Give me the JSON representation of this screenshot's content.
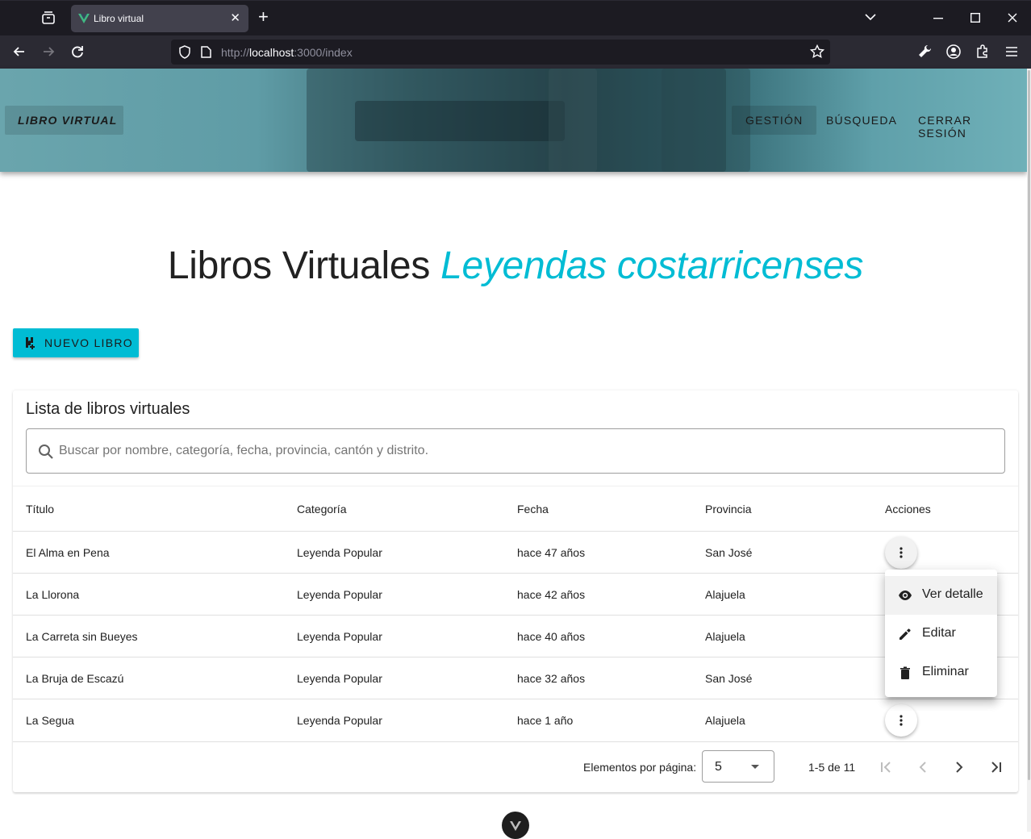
{
  "browser": {
    "tab_title": "Libro virtual",
    "url_prefix": "http://",
    "url_host": "localhost",
    "url_rest": ":3000/index"
  },
  "navbar": {
    "brand": "LIBRO VIRTUAL",
    "items": [
      {
        "label": "GESTIÓN",
        "active": true
      },
      {
        "label": "BÚSQUEDA",
        "active": false
      },
      {
        "label": "CERRAR SESIÓN",
        "active": false
      }
    ]
  },
  "heading": {
    "main": "Libros Virtuales",
    "accent": "Leyendas costarricenses"
  },
  "new_book_button": "NUEVO LIBRO",
  "card": {
    "title": "Lista de libros virtuales",
    "search_placeholder": "Buscar por nombre, categoría, fecha, provincia, cantón y distrito."
  },
  "table": {
    "headers": [
      "Título",
      "Categoría",
      "Fecha",
      "Provincia",
      "Acciones"
    ],
    "rows": [
      [
        "El Alma en Pena",
        "Leyenda Popular",
        "hace 47 años",
        "San José"
      ],
      [
        "La Llorona",
        "Leyenda Popular",
        "hace 42 años",
        "Alajuela"
      ],
      [
        "La Carreta sin Bueyes",
        "Leyenda Popular",
        "hace 40 años",
        "Alajuela"
      ],
      [
        "La Bruja de Escazú",
        "Leyenda Popular",
        "hace 32 años",
        "San José"
      ],
      [
        "La Segua",
        "Leyenda Popular",
        "hace 1 año",
        "Alajuela"
      ]
    ]
  },
  "pagination": {
    "per_page_label": "Elementos por página:",
    "per_page_value": "5",
    "range": "1-5 de 11"
  },
  "action_menu": {
    "items": [
      "Ver detalle",
      "Editar",
      "Eliminar"
    ]
  },
  "colors": {
    "accent": "#00bcd4",
    "browser_bg": "#1c1b22",
    "toolbar_bg": "#2b2a33"
  }
}
